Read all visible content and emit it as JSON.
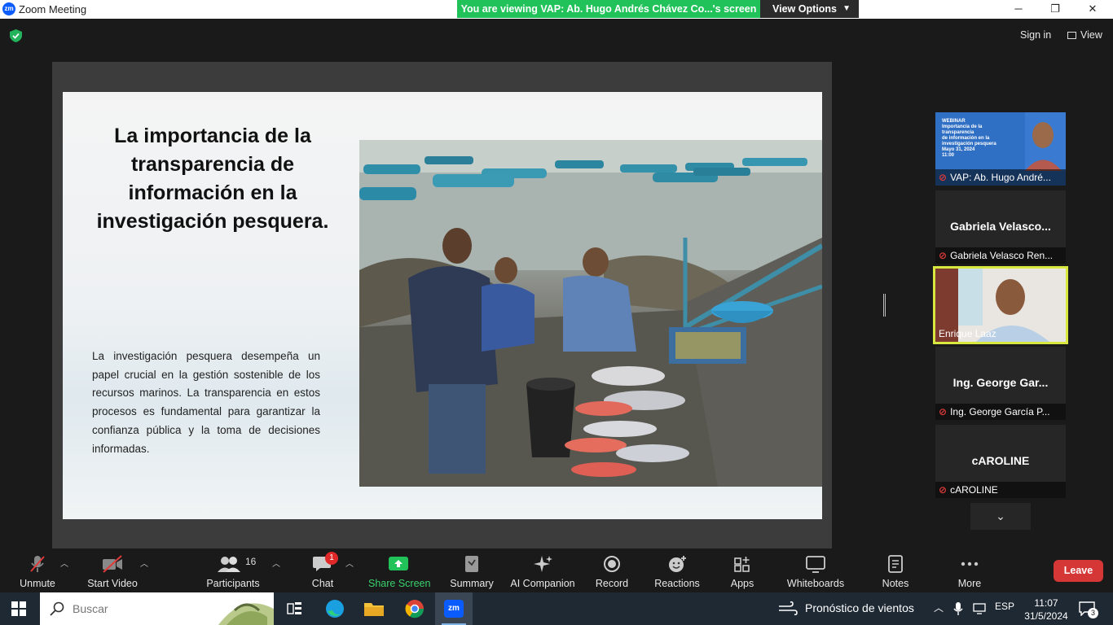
{
  "window": {
    "title": "Zoom Meeting",
    "logo_text": "zm",
    "viewing_banner": "You are viewing VAP: Ab. Hugo Andrés Chávez Co...'s screen",
    "view_options_label": "View Options",
    "controls": {
      "minimize": "─",
      "maximize": "❐",
      "close": "✕"
    }
  },
  "header": {
    "sign_in_label": "Sign in",
    "view_label": "View"
  },
  "slide": {
    "title": "La importancia de la transparencia de información en la investigación pesquera.",
    "body": "La investigación pesquera desempeña un papel crucial en la gestión sostenible de los recursos marinos. La transparencia en estos procesos es fundamental para garantizar la confianza pública y la toma de decisiones informadas."
  },
  "gallery": {
    "tiles": [
      {
        "label": "VAP: Ab. Hugo André...",
        "thumb_heading": "WEBINAR",
        "thumb_lines": [
          "Importancia de la",
          "transparencia",
          "de información en la",
          "investigación pesquera"
        ],
        "thumb_date": "Mayo 31, 2024",
        "thumb_time": "11:00",
        "muted": true
      },
      {
        "name": "Gabriela Velasco...",
        "label": "Gabriela Velasco Ren...",
        "muted": true
      },
      {
        "label": "Enrique Laaz",
        "muted": false,
        "active": true
      },
      {
        "name": "Ing. George Gar...",
        "label": "Ing. George García P...",
        "muted": true
      },
      {
        "name": "cAROLINE",
        "label": "cAROLINE",
        "muted": true
      }
    ],
    "scroll_icon": "chevron-down-icon"
  },
  "toolbar": {
    "unmute": "Unmute",
    "start_video": "Start Video",
    "participants": "Participants",
    "participants_count": "16",
    "chat": "Chat",
    "chat_badge": "1",
    "share_screen": "Share Screen",
    "summary": "Summary",
    "ai_companion": "AI Companion",
    "record": "Record",
    "reactions": "Reactions",
    "apps": "Apps",
    "whiteboards": "Whiteboards",
    "notes": "Notes",
    "more": "More",
    "leave": "Leave",
    "accent_green": "#21c25a",
    "leave_color": "#d53636"
  },
  "taskbar": {
    "search_placeholder": "Buscar",
    "weather": "Pronóstico de vientos",
    "language": "ESP",
    "time": "11:07",
    "date": "31/5/2024",
    "notification_count": "3"
  }
}
